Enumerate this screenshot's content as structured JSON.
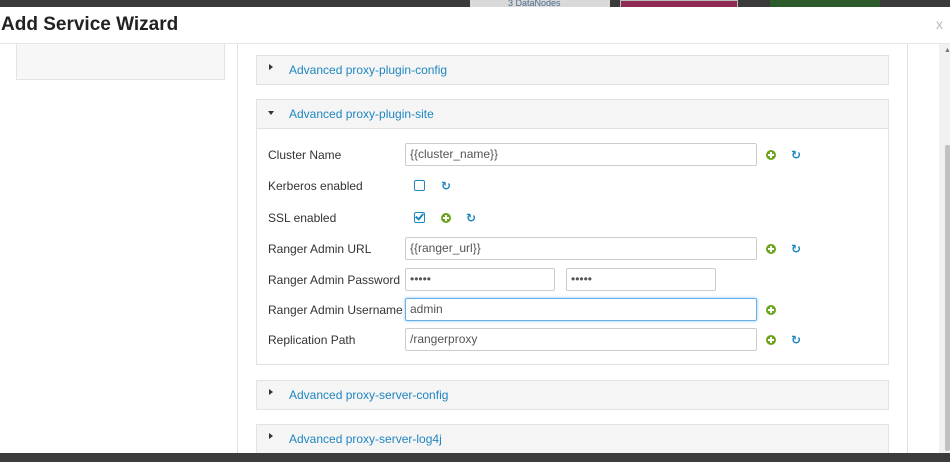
{
  "background": {
    "datanodes_text": "3 DataNodes"
  },
  "modal": {
    "title": "Add Service Wizard",
    "close": "x"
  },
  "sections": {
    "plugin_config": {
      "title": "Advanced proxy-plugin-config",
      "expanded": false
    },
    "plugin_site": {
      "title": "Advanced proxy-plugin-site",
      "expanded": true
    },
    "server_config": {
      "title": "Advanced proxy-server-config",
      "expanded": false
    },
    "server_log4j": {
      "title": "Advanced proxy-server-log4j",
      "expanded": false
    }
  },
  "fields": {
    "cluster_name": {
      "label": "Cluster Name",
      "value": "{{cluster_name}}"
    },
    "kerberos": {
      "label": "Kerberos enabled",
      "checked": false
    },
    "ssl": {
      "label": "SSL enabled",
      "checked": true
    },
    "ranger_url": {
      "label": "Ranger Admin URL",
      "value": "{{ranger_url}}"
    },
    "ranger_password": {
      "label": "Ranger Admin Password",
      "value": "•••••",
      "confirm_value": "•••••"
    },
    "ranger_username": {
      "label": "Ranger Admin Username",
      "value": "admin"
    },
    "replication_path": {
      "label": "Replication Path",
      "value": "/rangerproxy"
    }
  },
  "icons": {
    "add": "plus-circle-icon",
    "undo": "refresh-icon",
    "refresh_glyph": "↻"
  },
  "colors": {
    "link": "#1f86c1",
    "add_green": "#6aa51d",
    "focus": "#66afe9"
  }
}
